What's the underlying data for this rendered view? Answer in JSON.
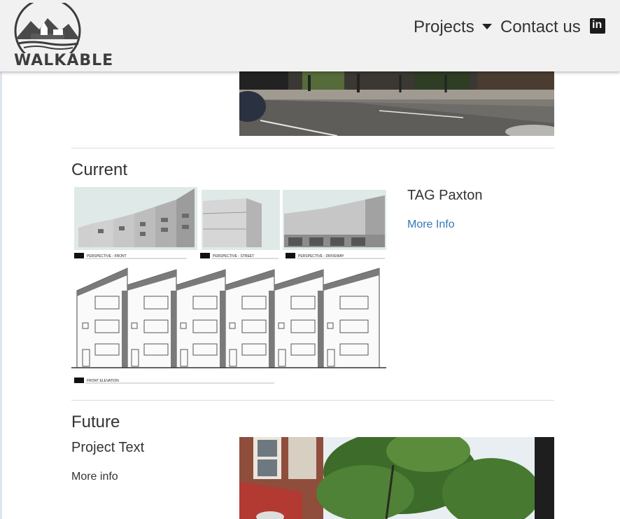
{
  "brand": {
    "name": "WALKABLE"
  },
  "nav": {
    "projects_label": "Projects",
    "contact_label": "Contact us",
    "linkedin_label": "in"
  },
  "sections": {
    "current": {
      "heading": "Current",
      "project_title": "TAG Paxton",
      "link_label": "More Info",
      "drawing_labels": {
        "front": "PERSPECTIVE - FRONT",
        "street": "PERSPECTIVE - STREET",
        "driveway": "PERSPECTIVE - DRIVEWAY",
        "elevation": "FRONT ELEVATION"
      }
    },
    "future": {
      "heading": "Future",
      "project_title": "Project Text",
      "link_label": "More info"
    }
  },
  "colors": {
    "link": "#337ab7",
    "navbar_bg": "#f1f1f1",
    "divider": "#dcdcdc"
  }
}
